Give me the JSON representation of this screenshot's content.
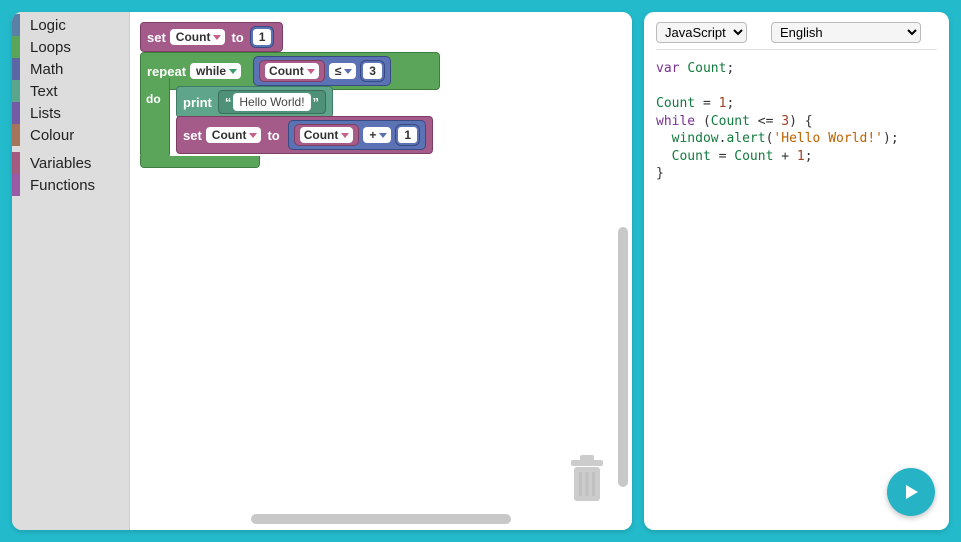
{
  "toolbox": {
    "items": [
      {
        "label": "Logic",
        "color": "#5b80a5"
      },
      {
        "label": "Loops",
        "color": "#5ba55b"
      },
      {
        "label": "Math",
        "color": "#5b67a5"
      },
      {
        "label": "Text",
        "color": "#5ba58c"
      },
      {
        "label": "Lists",
        "color": "#745ba5"
      },
      {
        "label": "Colour",
        "color": "#a5745b"
      }
    ],
    "items2": [
      {
        "label": "Variables",
        "color": "#a55b80"
      },
      {
        "label": "Functions",
        "color": "#995ba5"
      }
    ]
  },
  "blocks": {
    "set1": {
      "kw": "set",
      "var": "Count",
      "to": "to",
      "value": "1"
    },
    "repeat": {
      "kw": "repeat",
      "mode": "while",
      "var": "Count",
      "op": "≤",
      "limit": "3"
    },
    "do": {
      "kw": "do"
    },
    "print": {
      "kw": "print",
      "text": "Hello World!"
    },
    "set2": {
      "kw": "set",
      "var": "Count",
      "to": "to",
      "inner_var": "Count",
      "op": "+",
      "value": "1"
    }
  },
  "code_panel": {
    "lang_options": [
      "JavaScript"
    ],
    "lang_selected": "JavaScript",
    "locale_options": [
      "English"
    ],
    "locale_selected": "English"
  },
  "code": {
    "l1a": "var ",
    "l1b": "Count",
    "l1c": ";",
    "l3a": "Count",
    "l3b": " = ",
    "l3c": "1",
    "l3d": ";",
    "l4a": "while ",
    "l4b": "(",
    "l4c": "Count",
    "l4d": " <= ",
    "l4e": "3",
    "l4f": ") {",
    "l5a": "  ",
    "l5b": "window",
    "l5c": ".",
    "l5d": "alert",
    "l5e": "(",
    "l5f": "'Hello World!'",
    "l5g": ");",
    "l6a": "  ",
    "l6b": "Count",
    "l6c": " = ",
    "l6d": "Count",
    "l6e": " + ",
    "l6f": "1",
    "l6g": ";",
    "l7a": "}"
  }
}
